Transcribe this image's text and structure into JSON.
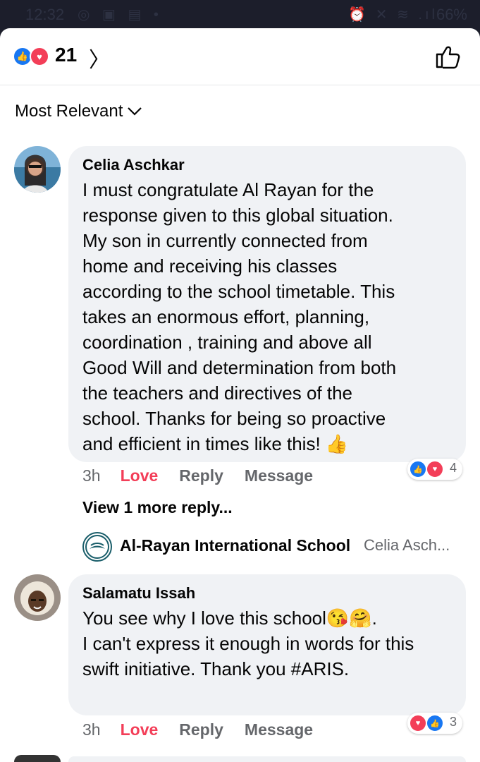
{
  "status_bar": {
    "time": "12:32",
    "battery": "66%"
  },
  "header": {
    "reaction_count": "21"
  },
  "sort": {
    "label": "Most Relevant"
  },
  "comments": [
    {
      "author": "Celia Aschkar",
      "lines": [
        "I must congratulate Al Rayan for the",
        "response given to this global situation.",
        "My son in currently connected from",
        "home and receiving his classes",
        "according to the school timetable. This",
        "takes an enormous effort, planning,",
        "coordination , training and above all",
        "Good Will and determination from both",
        "the teachers and directives of the",
        "school. Thanks for being so proactive",
        "and efficient in times like this! 👍"
      ],
      "time": "3h",
      "love": "Love",
      "reply": "Reply",
      "message": "Message",
      "reaction_count": "4"
    },
    {
      "author": "Salamatu Issah",
      "lines": [
        "You see why I love this school😘🤗.",
        "I can't express it enough in words for this",
        "swift initiative. Thank you #ARIS."
      ],
      "time": "3h",
      "love": "Love",
      "reply": "Reply",
      "message": "Message",
      "reaction_count": "3"
    }
  ],
  "view_more": "View 1 more reply...",
  "reply_preview": {
    "name": "Al-Rayan International School",
    "snippet": "Celia Asch..."
  },
  "colors": {
    "like_blue": "#1877f2",
    "love_red": "#f33e58",
    "bubble_gray": "#f0f2f5"
  }
}
